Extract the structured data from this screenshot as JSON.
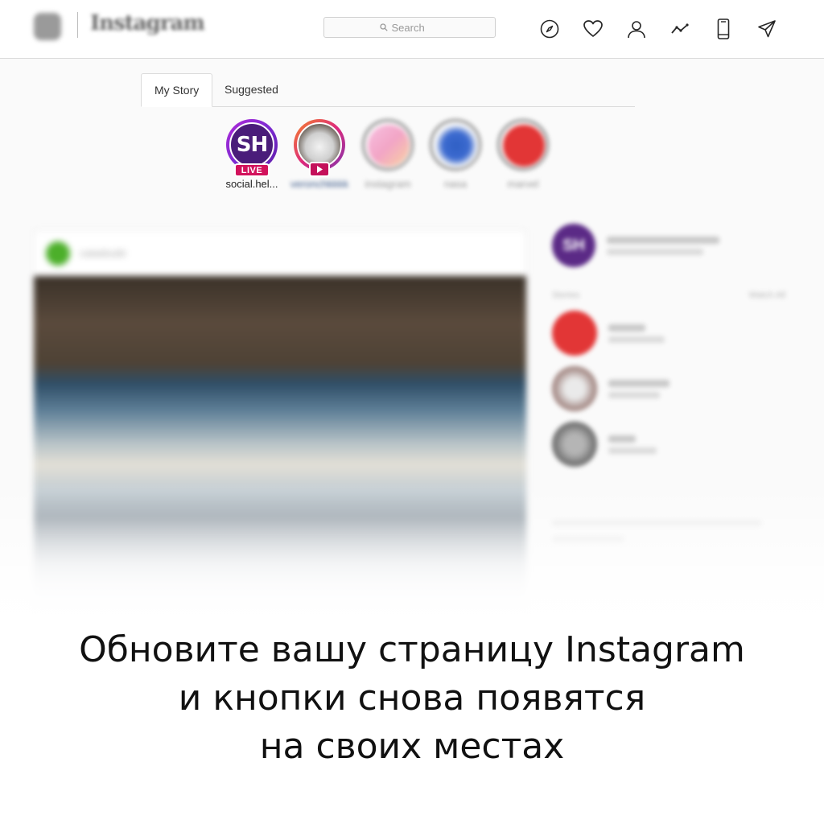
{
  "header": {
    "logo_text": "Instagram",
    "search_placeholder": "Search",
    "nav_icons": [
      "compass-icon",
      "heart-icon",
      "profile-icon",
      "stats-icon",
      "phone-icon",
      "direct-icon"
    ]
  },
  "tabs": [
    {
      "label": "My Story",
      "active": true
    },
    {
      "label": "Suggested",
      "active": false
    }
  ],
  "stories": [
    {
      "name": "social.hel...",
      "initials": "SH",
      "badge": "LIVE",
      "ring_color": "#8e2de2"
    },
    {
      "name": "veronchkkkk",
      "badge": "play",
      "ring_color": "#d6249f"
    },
    {
      "name": "instagram",
      "ring_color": "#8a8a8a"
    },
    {
      "name": "nasa",
      "ring_color": "#8a8a8a"
    },
    {
      "name": "marvel",
      "ring_color": "#8a8a8a"
    }
  ],
  "post": {
    "username": "catadoubt"
  },
  "sidebar": {
    "profile_initials": "SH",
    "stories_label": "Stories",
    "watch_all": "Watch All"
  },
  "caption": {
    "line1": "Обновите вашу страницу Instagram",
    "line2": "и кнопки снова появятся",
    "line3": "на своих местах"
  },
  "colors": {
    "live_badge": "#d2125c",
    "accent_purple": "#5b2a86",
    "marvel_red": "#e23636"
  }
}
